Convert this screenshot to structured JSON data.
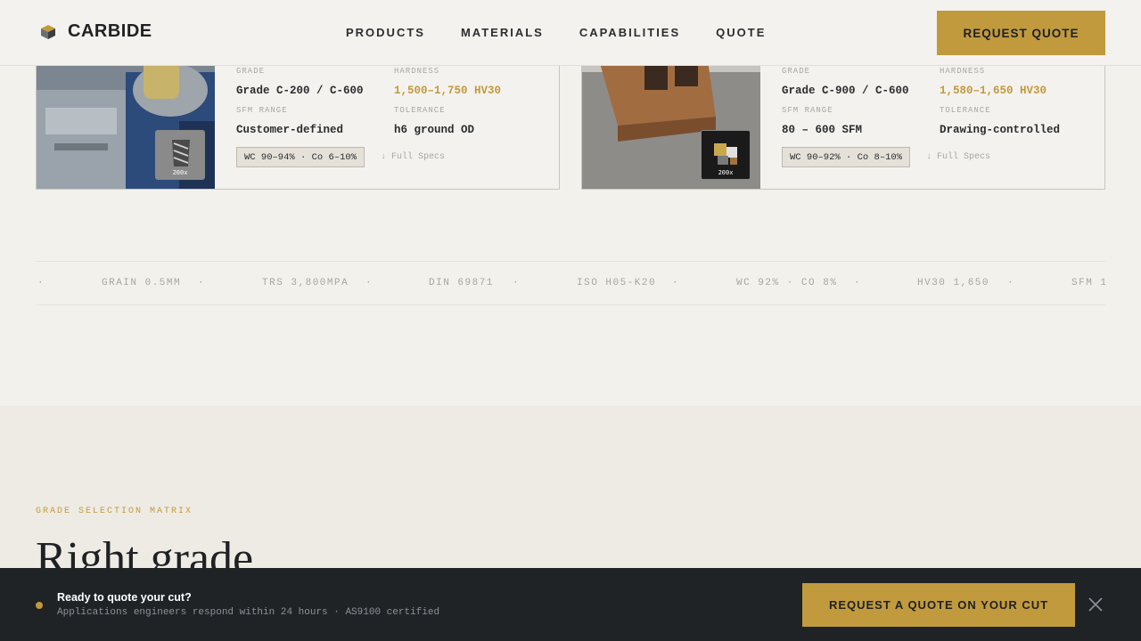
{
  "header": {
    "brand": "CARBIDE",
    "nav": [
      "PRODUCTS",
      "MATERIALS",
      "CAPABILITIES",
      "QUOTE"
    ],
    "cta_label": "REQUEST QUOTE"
  },
  "cards": [
    {
      "thumb_label": "200x",
      "grade_label": "GRADE",
      "grade_value": "Grade C-200 / C-600",
      "hardness_label": "HARDNESS",
      "hardness_value": "1,500–1,750 HV30",
      "sfm_label": "SFM RANGE",
      "sfm_value": "Customer-defined",
      "tolerance_label": "TOLERANCE",
      "tolerance_value": "h6 ground OD",
      "composition": "WC 90–94% · Co 6–10%",
      "full_specs": "↓ Full Specs"
    },
    {
      "thumb_label": "200x",
      "grade_label": "GRADE",
      "grade_value": "Grade C-900 / C-600",
      "hardness_label": "HARDNESS",
      "hardness_value": "1,580–1,650 HV30",
      "sfm_label": "SFM RANGE",
      "sfm_value": "80 – 600 SFM",
      "tolerance_label": "TOLERANCE",
      "tolerance_value": "Drawing-controlled",
      "composition": "WC 90–92% · Co 8–10%",
      "full_specs": "↓ Full Specs"
    }
  ],
  "ticker": {
    "items": [
      "GRAIN 0.5MM",
      "TRS 3,800MPA",
      "DIN 69871",
      "ISO H05-K20",
      "WC 92% · CO 8%",
      "HV30 1,650",
      "SFM 1"
    ],
    "separator": "·"
  },
  "section": {
    "eyebrow": "GRADE SELECTION MATRIX",
    "title": "Right grade"
  },
  "bottom_bar": {
    "title": "Ready to quote your cut?",
    "subtitle": "Applications engineers respond within 24 hours · AS9100 certified",
    "cta_label": "REQUEST A QUOTE ON YOUR CUT"
  },
  "colors": {
    "accent": "#c19a3e",
    "background": "#f3f1ec",
    "dark": "#1f2326"
  }
}
